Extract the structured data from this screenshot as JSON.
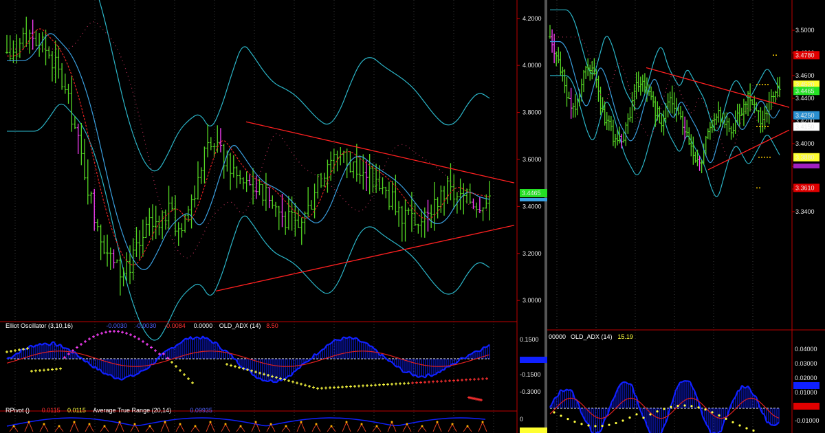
{
  "colors": {
    "background": "#000000",
    "grid": "#3a3a3a",
    "axis_line": "#c00000",
    "up_bar": "#55d824",
    "down_bar": "#ff40ff",
    "bollinger": "#2bb5c8",
    "moving_average": "#3aa0e0",
    "slow_average": "#e02020",
    "trend_line": "#ff2020",
    "oscillator": "#1020ff",
    "zero_line": "#ffffff",
    "sar_up": "#ff40ff",
    "sar_down": "#ffff40",
    "signal_line": "#e02020"
  },
  "left_chart": {
    "price_ticks": [
      "4.2000",
      "4.0000",
      "3.8000",
      "3.6000",
      "3.4000",
      "3.2000",
      "3.0000"
    ],
    "price_tag": "3.4465",
    "oscillator_ticks": [
      "0.1500",
      "-0.1500",
      "-0.3000"
    ],
    "pivot_ticks": [
      "0"
    ],
    "oscillator_legend": [
      {
        "text": "Elliot Oscillator (3,10,16)",
        "color": "#ffffff"
      },
      {
        "text": "-0.0030",
        "color": "#5060ff"
      },
      {
        "text": "-0.0030",
        "color": "#5060ff"
      },
      {
        "text": "-0.0084",
        "color": "#ff3030"
      },
      {
        "text": "0.0000",
        "color": "#ffffff"
      },
      {
        "text": "OLD_ADX (14)",
        "color": "#ffffff"
      },
      {
        "text": "8.50",
        "color": "#ff3030"
      }
    ],
    "pivot_legend": [
      {
        "text": "RPivot ()",
        "color": "#ffffff"
      },
      {
        "text": "0.0115",
        "color": "#ff3030"
      },
      {
        "text": "0.0115",
        "color": "#ffff40"
      },
      {
        "text": "Average True Range (20,14)",
        "color": "#ffffff"
      },
      {
        "text": "0.09935",
        "color": "#5060ff"
      }
    ]
  },
  "right_chart": {
    "price_ticks": [
      "3.5000",
      "3.4800",
      "3.4600",
      "3.4400",
      "3.4200",
      "3.4000",
      "3.3800",
      "3.3600",
      "3.3400"
    ],
    "tags": [
      "3.4780",
      "3.4520",
      "3.4465",
      "3.4250",
      "3.4150",
      "3.3880",
      "3.3610"
    ],
    "oscillator_ticks": [
      "0.04000",
      "0.03000",
      "0.02000",
      "0.01000",
      "-0.01000"
    ],
    "oscillator_legend": [
      {
        "text": "00000",
        "color": "#ffffff"
      },
      {
        "text": "OLD_ADX (14)",
        "color": "#ffffff"
      },
      {
        "text": "15.19",
        "color": "#ffff40"
      }
    ]
  },
  "chart_data": [
    {
      "type": "candlestick",
      "title": "",
      "ylim": [
        2.98,
        4.22
      ],
      "series": [
        {
          "name": "",
          "close_path": [
            4.02,
            4.08,
            4.15,
            4.1,
            4.05,
            3.95,
            3.8,
            3.6,
            3.4,
            3.25,
            3.15,
            3.12,
            3.2,
            3.3,
            3.35,
            3.38,
            3.3,
            3.4,
            3.55,
            3.68,
            3.62,
            3.55,
            3.5,
            3.48,
            3.45,
            3.4,
            3.35,
            3.32,
            3.38,
            3.5,
            3.6,
            3.62,
            3.58,
            3.55,
            3.52,
            3.48,
            3.42,
            3.36,
            3.32,
            3.34,
            3.42,
            3.47,
            3.44,
            3.43,
            3.42,
            3.44
          ]
        }
      ],
      "trend_lines": [
        {
          "from": [
            3.76
          ],
          "to": [
            3.5
          ]
        },
        {
          "from": [
            3.04
          ],
          "to": [
            3.32
          ]
        }
      ]
    },
    {
      "type": "candlestick",
      "title": "",
      "ylim": [
        3.33,
        3.51
      ],
      "series": [
        {
          "name": "",
          "close_path": [
            3.49,
            3.48,
            3.46,
            3.44,
            3.43,
            3.45,
            3.47,
            3.46,
            3.44,
            3.42,
            3.41,
            3.4,
            3.41,
            3.43,
            3.45,
            3.46,
            3.44,
            3.43,
            3.42,
            3.44,
            3.43,
            3.42,
            3.41,
            3.39,
            3.38,
            3.4,
            3.42,
            3.43,
            3.42,
            3.41,
            3.42,
            3.43,
            3.44,
            3.43,
            3.42,
            3.43,
            3.44,
            3.45
          ]
        }
      ],
      "trend_lines": [
        {
          "from": [
            3.467
          ],
          "to": [
            3.432
          ]
        },
        {
          "from": [
            3.377
          ],
          "to": [
            3.412
          ]
        }
      ]
    }
  ]
}
